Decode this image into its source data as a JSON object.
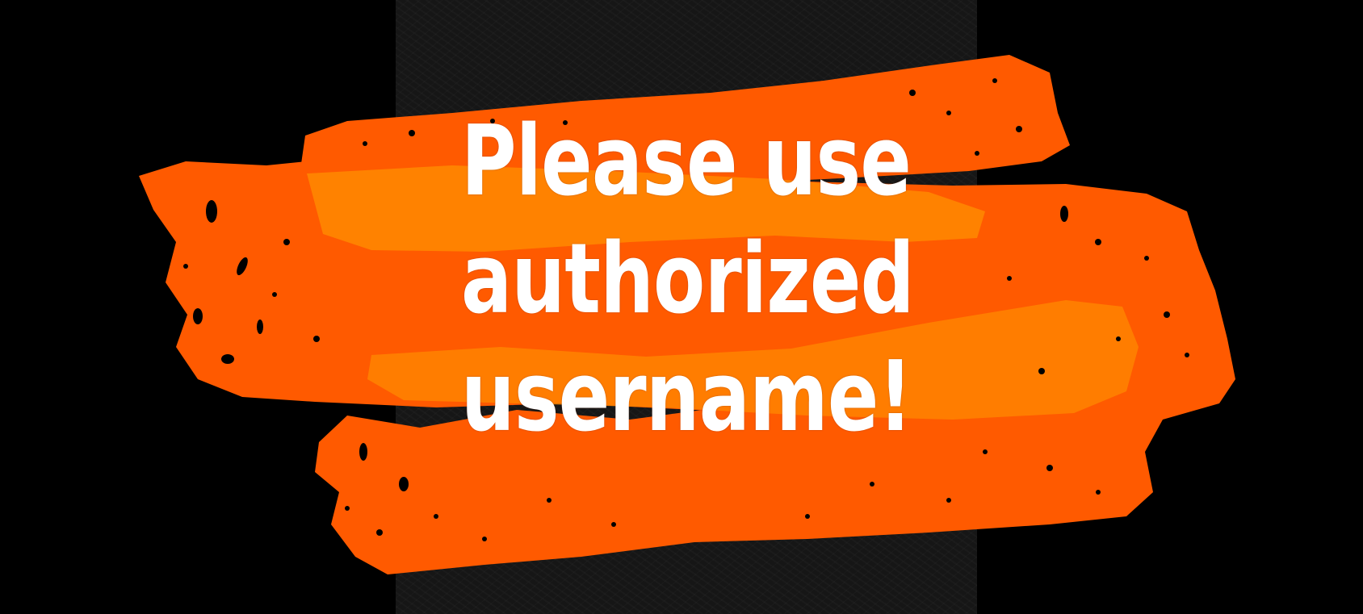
{
  "message": {
    "line1": "Please use",
    "line2": "authorized",
    "line3": "username!"
  },
  "colors": {
    "background": "#000000",
    "brush_primary": "#ff5a00",
    "brush_highlight": "#ff8a00",
    "text": "#ffffff"
  }
}
